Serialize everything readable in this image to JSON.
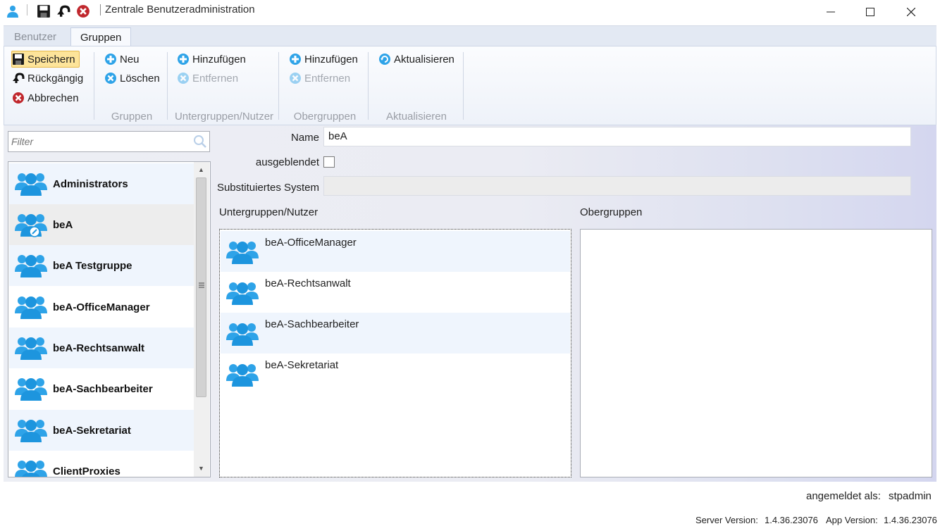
{
  "window": {
    "title": "Zentrale Benutzeradministration",
    "app_icon": "user-icon",
    "quick_access": [
      "save-icon",
      "undo-icon",
      "cancel-icon"
    ],
    "controls": {
      "minimize": "—",
      "maximize": "☐",
      "close": "✕"
    }
  },
  "tabs": [
    {
      "label": "Benutzer",
      "active": false
    },
    {
      "label": "Gruppen",
      "active": true
    }
  ],
  "ribbon": {
    "save": "Speichern",
    "undo": "Rückgängig",
    "cancel": "Abbrechen",
    "gruppen": {
      "new": "Neu",
      "delete": "Löschen",
      "title": "Gruppen"
    },
    "untergruppen": {
      "add": "Hinzufügen",
      "remove": "Entfernen",
      "title": "Untergruppen/Nutzer"
    },
    "obergruppen": {
      "add": "Hinzufügen",
      "remove": "Entfernen",
      "title": "Obergruppen"
    },
    "aktualisieren": {
      "refresh": "Aktualisieren",
      "title": "Aktualisieren"
    }
  },
  "filter": {
    "placeholder": "Filter",
    "value": ""
  },
  "groups": [
    {
      "label": "Administrators"
    },
    {
      "label": "beA"
    },
    {
      "label": "beA Testgruppe"
    },
    {
      "label": "beA-OfficeManager"
    },
    {
      "label": "beA-Rechtsanwalt"
    },
    {
      "label": "beA-Sachbearbeiter"
    },
    {
      "label": "beA-Sekretariat"
    },
    {
      "label": "ClientProxies"
    }
  ],
  "selected_group": "beA",
  "form": {
    "name_label": "Name",
    "name_value": "beA",
    "hidden_label": "ausgeblendet",
    "hidden_checked": false,
    "subst_label": "Substituiertes System",
    "subst_value": "",
    "sub_header": "Untergruppen/Nutzer",
    "ober_header": "Obergruppen"
  },
  "subgroups": [
    {
      "label": "beA-OfficeManager"
    },
    {
      "label": "beA-Rechtsanwalt"
    },
    {
      "label": "beA-Sachbearbeiter"
    },
    {
      "label": "beA-Sekretariat"
    }
  ],
  "obergruppen": [],
  "status": {
    "logged_in_label": "angemeldet als:",
    "logged_in_user": "stpadmin",
    "server_version_label": "Server Version:",
    "server_version": "1.4.36.23076",
    "app_version_label": "App Version:",
    "app_version": "1.4.36.23076"
  },
  "colors": {
    "accent_blue": "#2ea3e8",
    "highlight": "#fde49a",
    "alt_row": "#eff5fd"
  }
}
